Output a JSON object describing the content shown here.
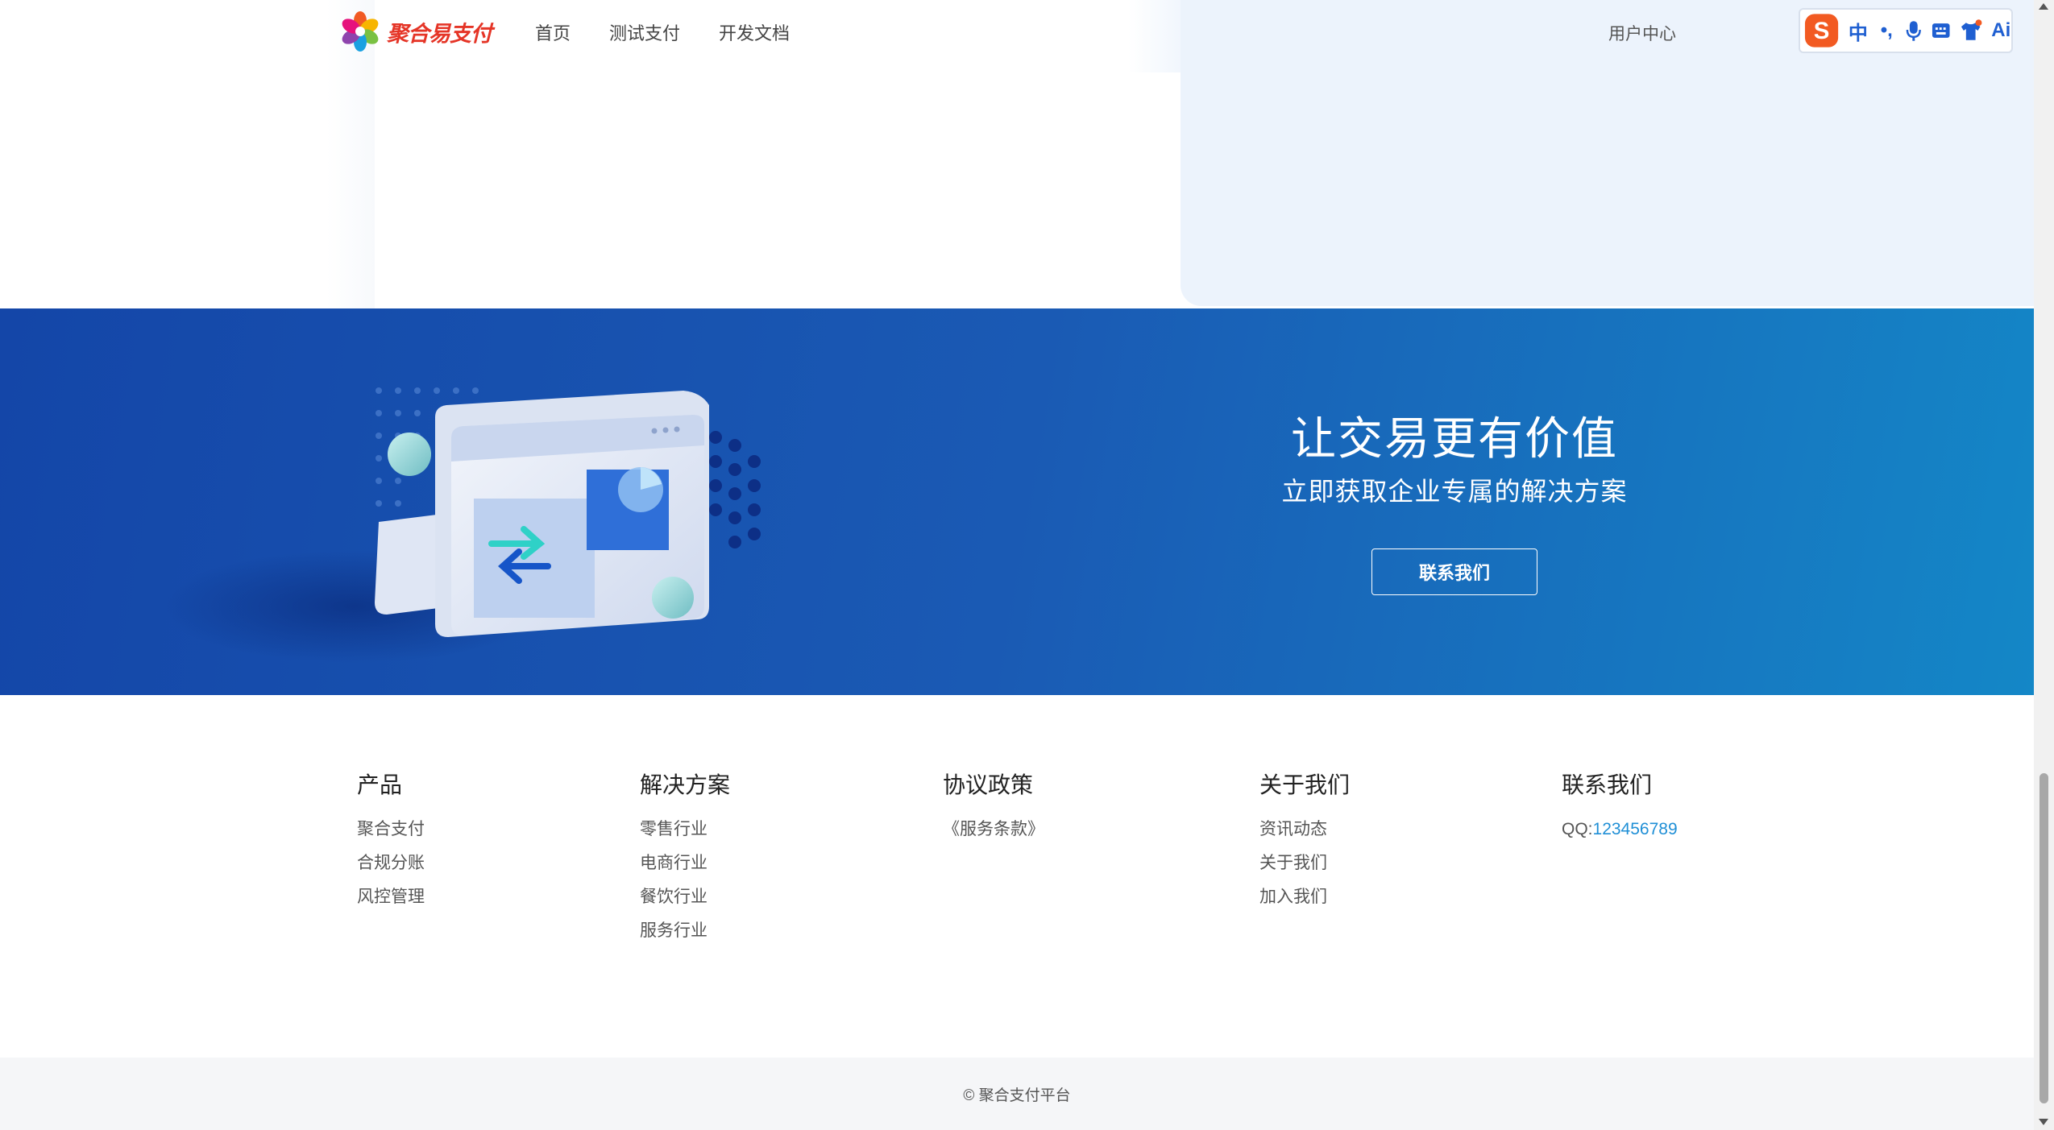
{
  "brand": {
    "name": "聚合易支付"
  },
  "nav": {
    "links": [
      "首页",
      "测试支付",
      "开发文档"
    ],
    "user_center": "用户中心"
  },
  "ime_toolbar": {
    "items": [
      {
        "icon": "sogou-s-logo",
        "label": "S"
      },
      {
        "icon": "chinese-mode",
        "label": "中"
      },
      {
        "icon": "punctuation",
        "label": "•,"
      },
      {
        "icon": "microphone-icon",
        "label": ""
      },
      {
        "icon": "keyboard-icon",
        "label": ""
      },
      {
        "icon": "shirt-skin-icon",
        "label": ""
      },
      {
        "icon": "ai-icon",
        "label": "Ai"
      }
    ]
  },
  "banner": {
    "title": "让交易更有价值",
    "subtitle": "立即获取企业专属的解决方案",
    "button": "联系我们"
  },
  "footer": {
    "columns": [
      {
        "title": "产品",
        "links": [
          "聚合支付",
          "合规分账",
          "风控管理"
        ]
      },
      {
        "title": "解决方案",
        "links": [
          "零售行业",
          "电商行业",
          "餐饮行业",
          "服务行业"
        ]
      },
      {
        "title": "协议政策",
        "links": [
          "《服务条款》"
        ]
      },
      {
        "title": "关于我们",
        "links": [
          "资讯动态",
          "关于我们",
          "加入我们"
        ]
      },
      {
        "title": "联系我们",
        "qq_label": "QQ:",
        "qq_number": "123456789"
      }
    ],
    "copyright": "© 聚合支付平台"
  },
  "colors": {
    "brand_red": "#e53527",
    "banner_start": "#1446a8",
    "banner_end": "#1487c7",
    "link_blue": "#1f8fd6"
  }
}
